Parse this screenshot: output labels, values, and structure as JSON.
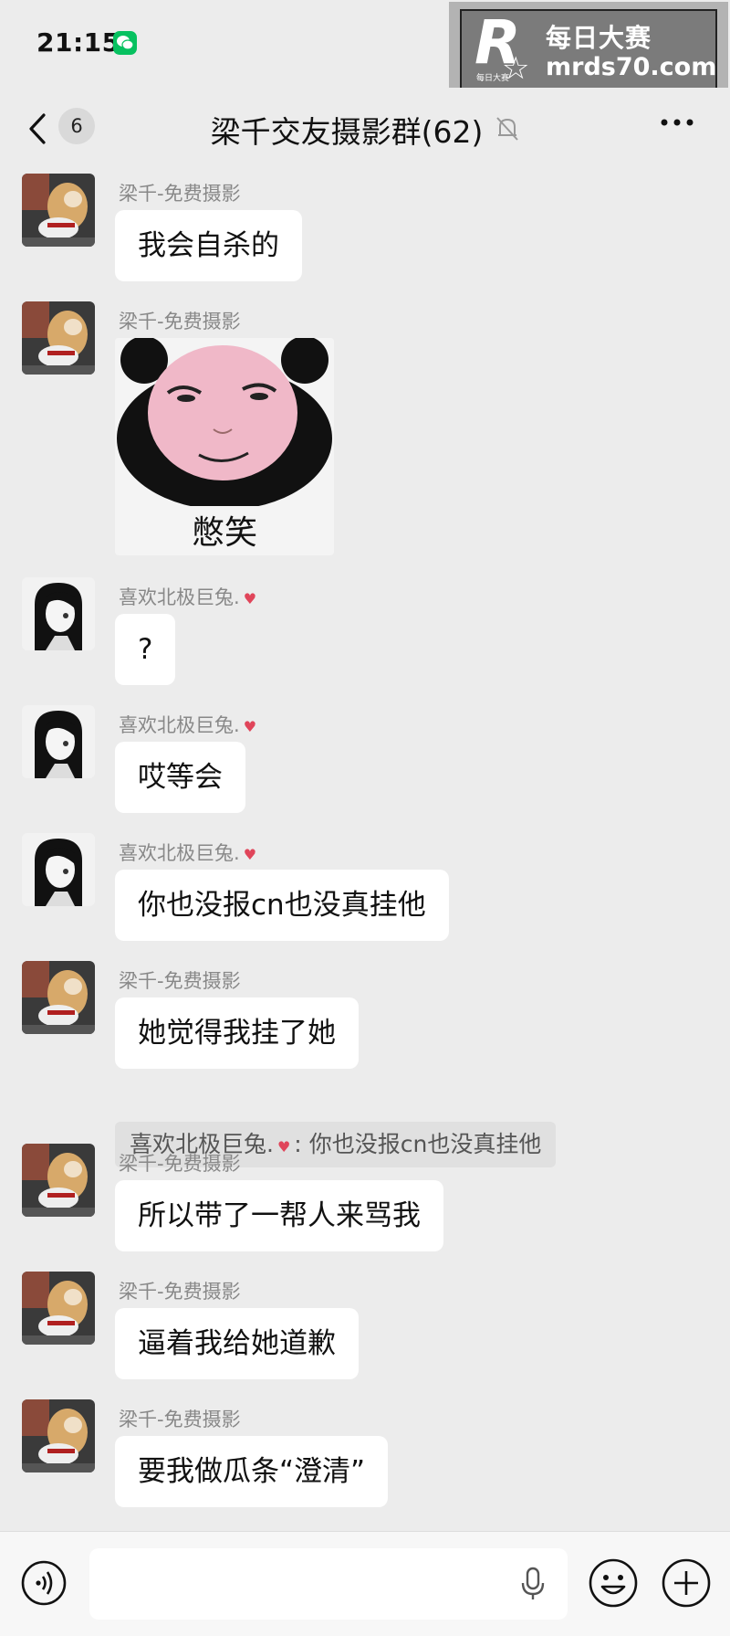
{
  "status_bar": {
    "time": "21:15",
    "app_icon": "wechat-icon"
  },
  "watermark": {
    "logo_letter": "R",
    "logo_small": "每日大赛",
    "title": "每日大赛",
    "url": "mrds70.com"
  },
  "nav": {
    "back_icon": "chevron-left-icon",
    "unread_count": "6",
    "title": "梁千交友摄影群(62)",
    "mute_icon": "bell-off-icon",
    "more_icon": "more-dots-icon"
  },
  "messages": [
    {
      "sender": "梁千-免费摄影",
      "text": "我会自杀的",
      "avatar": "dog-avatar"
    },
    {
      "sender": "梁千-免费摄影",
      "sticker_caption": "憋笑",
      "avatar": "dog-avatar"
    },
    {
      "sender": "喜欢北极巨兔.",
      "text": "?",
      "avatar": "anime-girl-avatar"
    },
    {
      "sender": "喜欢北极巨兔.",
      "text": "哎等会",
      "avatar": "anime-girl-avatar"
    },
    {
      "sender": "喜欢北极巨兔.",
      "text": "你也没报cn也没真挂他",
      "avatar": "anime-girl-avatar"
    },
    {
      "sender": "梁千-免费摄影",
      "text": "她觉得我挂了她",
      "avatar": "dog-avatar",
      "quote": {
        "sender": "喜欢北极巨兔.",
        "separator": ":",
        "text": "你也没报cn也没真挂他"
      }
    },
    {
      "sender": "梁千-免费摄影",
      "text": "所以带了一帮人来骂我",
      "avatar": "dog-avatar"
    },
    {
      "sender": "梁千-免费摄影",
      "text": "逼着我给她道歉",
      "avatar": "dog-avatar"
    },
    {
      "sender": "梁千-免费摄影",
      "text": "要我做瓜条“澄清”",
      "avatar": "dog-avatar"
    }
  ],
  "input_bar": {
    "voice_icon": "voice-icon",
    "mic_icon": "mic-icon",
    "emoji_icon": "emoji-icon",
    "plus_icon": "plus-icon"
  },
  "colors": {
    "background": "#ececec",
    "bubble": "#ffffff",
    "heart": "#e0455a",
    "wechat_green": "#07c160"
  }
}
